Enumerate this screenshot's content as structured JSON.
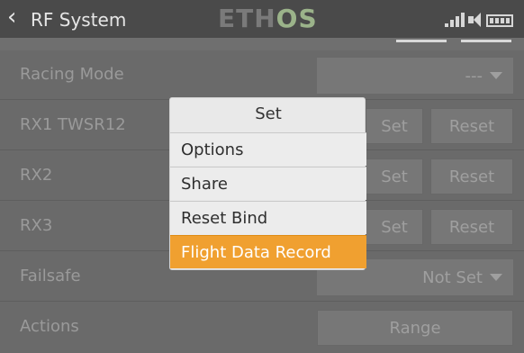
{
  "header": {
    "title": "RF System",
    "logo_left": "ETH",
    "logo_right": "OS"
  },
  "rows": {
    "racing_mode": {
      "label": "Racing Mode",
      "value": "---"
    },
    "rx1": {
      "label": "RX1  TWSR12",
      "set": "Set",
      "reset": "Reset"
    },
    "rx2": {
      "label": "RX2",
      "set": "Set",
      "reset": "Reset"
    },
    "rx3": {
      "label": "RX3",
      "set": "Set",
      "reset": "Reset"
    },
    "failsafe": {
      "label": "Failsafe",
      "value": "Not Set"
    },
    "actions": {
      "label": "Actions",
      "range": "Range"
    }
  },
  "menu": {
    "title": "Set",
    "items": [
      {
        "label": "Options"
      },
      {
        "label": "Share"
      },
      {
        "label": "Reset Bind"
      },
      {
        "label": "Flight Data Record"
      }
    ],
    "active_color": "#f0a030"
  },
  "icons": {
    "back": "chevron-left-icon",
    "signal": "signal-bars-icon",
    "volume": "speaker-icon",
    "battery": "battery-icon"
  }
}
